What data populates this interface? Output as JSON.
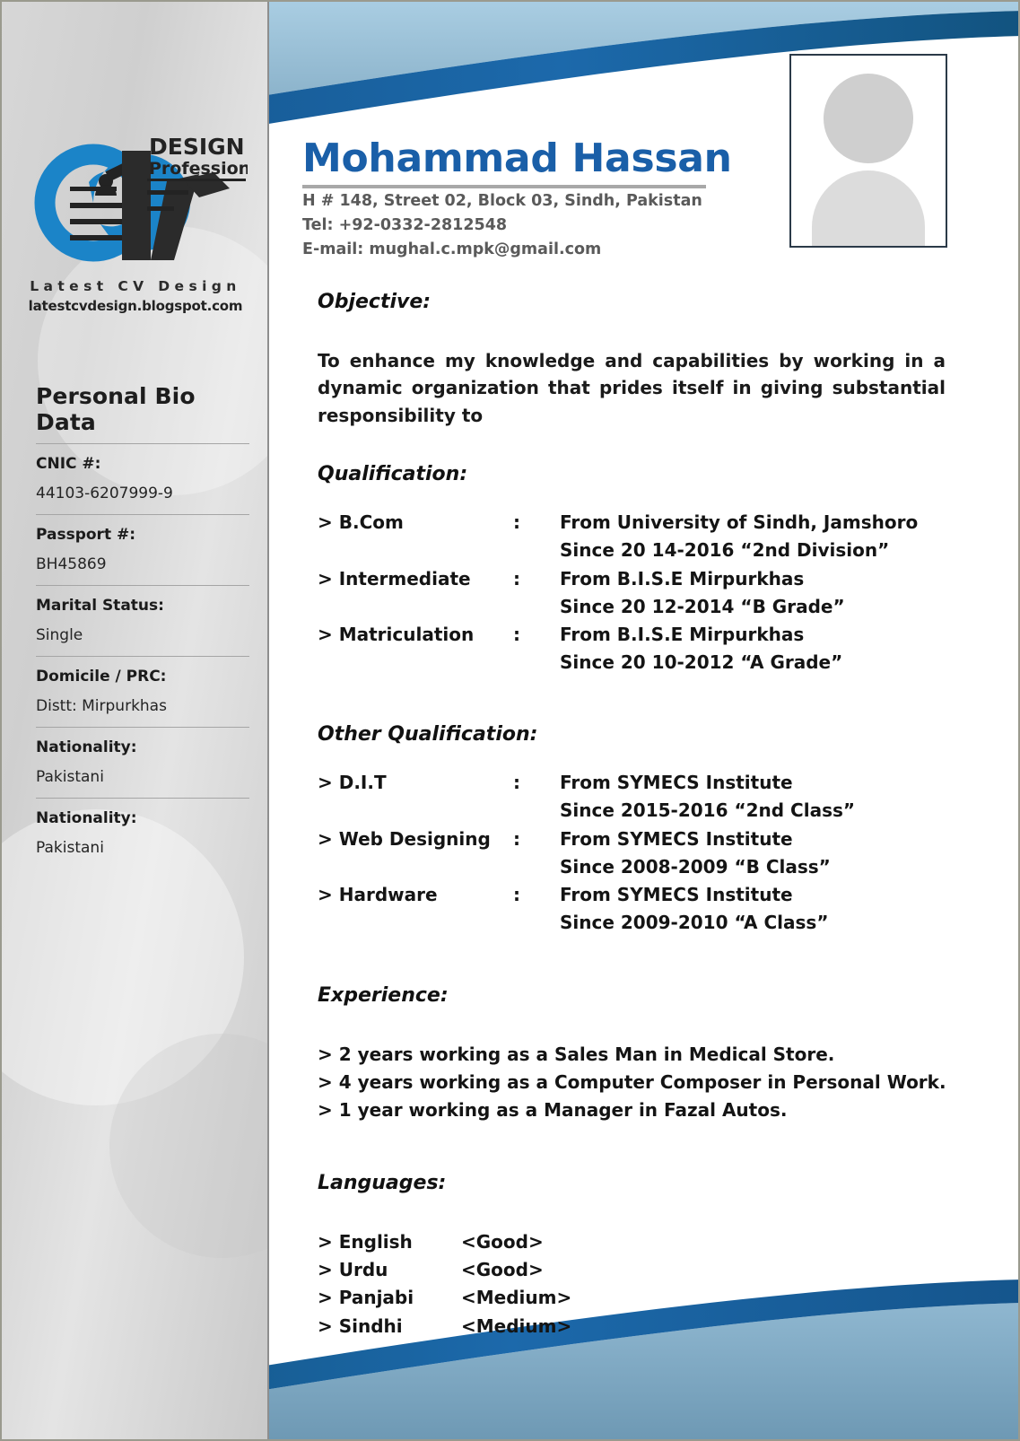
{
  "logo": {
    "brand_cv": "CV",
    "brand_design": "DESIGN",
    "brand_professional": "Professional",
    "tagline": "Latest CV Design",
    "url": "latestcvdesign.blogspot.com"
  },
  "sidebar": {
    "title": "Personal Bio Data",
    "fields": [
      {
        "label": "CNIC #:",
        "value": "44103-6207999-9"
      },
      {
        "label": "Passport #:",
        "value": "BH45869"
      },
      {
        "label": "Marital Status:",
        "value": "Single"
      },
      {
        "label": "Domicile / PRC:",
        "value": "Distt: Mirpurkhas"
      },
      {
        "label": "Nationality:",
        "value": "Pakistani"
      },
      {
        "label": "Nationality:",
        "value": "Pakistani"
      }
    ]
  },
  "header": {
    "name": "Mohammad Hassan",
    "address": "H # 148, Street 02, Block 03, Sindh, Pakistan",
    "tel": "Tel: +92-0332-2812548",
    "email": "E-mail: mughal.c.mpk@gmail.com",
    "photo_placeholder": "person-placeholder-icon"
  },
  "sections": {
    "objective": {
      "heading": "Objective:",
      "body": "To enhance my knowledge and capabilities by working in a dynamic organization that prides itself in giving substantial responsibility to"
    },
    "qualification": {
      "heading": "Qualification:",
      "items": [
        {
          "name": "> B.Com",
          "colon": ":",
          "from": "From University of Sindh, Jamshoro",
          "since": "Since 20 14-2016 “2nd Division”"
        },
        {
          "name": "> Intermediate",
          "colon": ":",
          "from": "From B.I.S.E Mirpurkhas",
          "since": "Since 20 12-2014 “B Grade”"
        },
        {
          "name": "> Matriculation",
          "colon": ":",
          "from": "From B.I.S.E Mirpurkhas",
          "since": "Since 20 10-2012 “A Grade”"
        }
      ]
    },
    "other_qualification": {
      "heading": "Other Qualification:",
      "items": [
        {
          "name": "> D.I.T",
          "colon": ":",
          "from": "From SYMECS Institute",
          "since": "Since 2015-2016 “2nd Class”"
        },
        {
          "name": "> Web Designing",
          "colon": ":",
          "from": "From SYMECS Institute",
          "since": "Since 2008-2009 “B Class”"
        },
        {
          "name": "> Hardware",
          "colon": ":",
          "from": "From SYMECS Institute",
          "since": "Since 2009-2010 “A Class”"
        }
      ]
    },
    "experience": {
      "heading": "Experience:",
      "items": [
        "> 2 years working as a Sales Man in Medical Store.",
        "> 4 years working as a Computer Composer in Personal Work.",
        "> 1 year working as a Manager in Fazal Autos."
      ]
    },
    "languages": {
      "heading": "Languages:",
      "items": [
        {
          "name": "> English",
          "level": "<Good>"
        },
        {
          "name": "> Urdu",
          "level": "<Good>"
        },
        {
          "name": "> Panjabi",
          "level": "<Medium>"
        },
        {
          "name": "> Sindhi",
          "level": "<Medium>"
        }
      ]
    }
  },
  "colors": {
    "accent_blue": "#1a5fa8",
    "swoosh_blue": "#14578f",
    "band_blue": "#8cb9d6",
    "sidebar_gray": "#d4d4d4",
    "logo_blue": "#1b84c8"
  }
}
